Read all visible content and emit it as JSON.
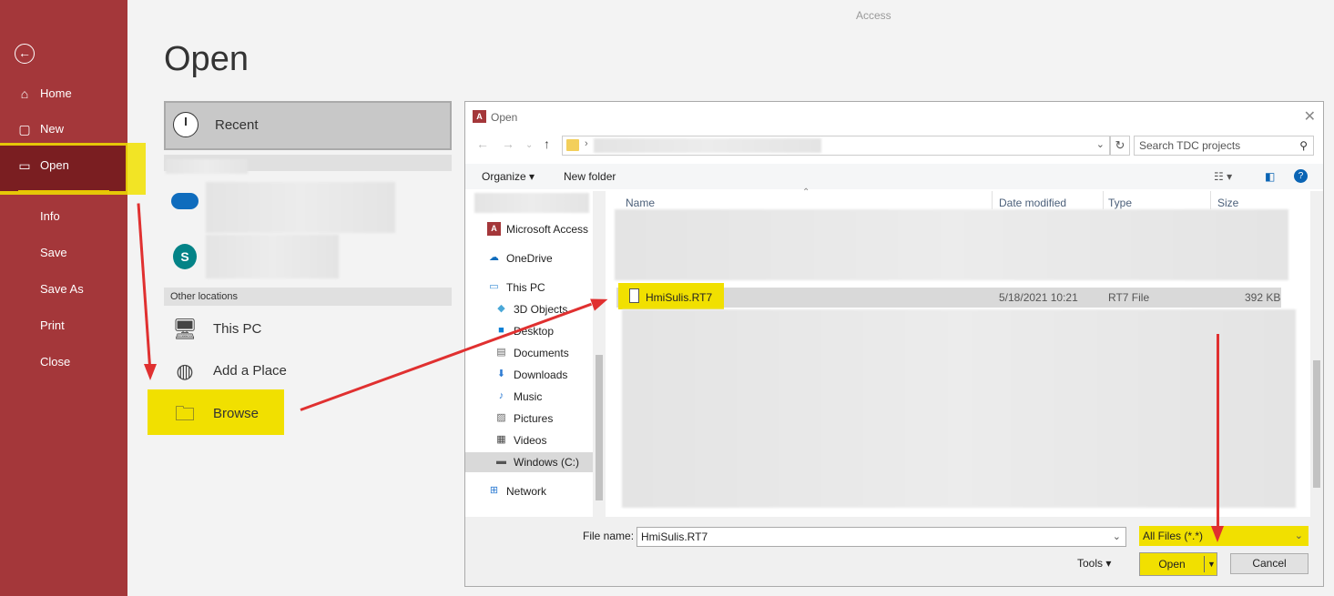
{
  "app_title": "Access",
  "backstage": {
    "back_icon": "back-arrow-icon",
    "nav": [
      {
        "label": "Home",
        "icon": "home-icon"
      },
      {
        "label": "New",
        "icon": "new-doc-icon"
      },
      {
        "label": "Open",
        "icon": "folder-open-icon",
        "active": true
      },
      {
        "label": "Info"
      },
      {
        "label": "Save"
      },
      {
        "label": "Save As"
      },
      {
        "label": "Print"
      },
      {
        "label": "Close"
      }
    ]
  },
  "open_page": {
    "title": "Open",
    "recent_label": "Recent",
    "other_locations_label": "Other locations",
    "locations": [
      {
        "label": "This PC",
        "icon": "pc-icon"
      },
      {
        "label": "Add a Place",
        "icon": "globe-icon"
      },
      {
        "label": "Browse",
        "icon": "folder-icon"
      }
    ]
  },
  "dialog": {
    "title": "Open",
    "search_placeholder": "Search TDC projects",
    "toolbar": {
      "organize": "Organize ▾",
      "new_folder": "New folder"
    },
    "tree": [
      {
        "label": "Microsoft Access",
        "icon": "access-icon"
      },
      {
        "label": "OneDrive",
        "icon": "cloud-icon"
      },
      {
        "label": "This PC",
        "icon": "pc-icon"
      },
      {
        "label": "3D Objects",
        "icon": "cube-icon"
      },
      {
        "label": "Desktop",
        "icon": "desktop-icon"
      },
      {
        "label": "Documents",
        "icon": "documents-icon"
      },
      {
        "label": "Downloads",
        "icon": "download-icon"
      },
      {
        "label": "Music",
        "icon": "music-icon"
      },
      {
        "label": "Pictures",
        "icon": "pictures-icon"
      },
      {
        "label": "Videos",
        "icon": "videos-icon"
      },
      {
        "label": "Windows (C:)",
        "icon": "drive-icon"
      },
      {
        "label": "Network",
        "icon": "network-icon"
      }
    ],
    "columns": {
      "name": "Name",
      "date": "Date modified",
      "type": "Type",
      "size": "Size"
    },
    "selected_file": {
      "name": "HmiSulis.RT7",
      "date": "5/18/2021 10:21",
      "type": "RT7 File",
      "size": "392 KB"
    },
    "file_name_label": "File name:",
    "file_name_value": "HmiSulis.RT7",
    "file_type": "All Files (*.*)",
    "tools_label": "Tools",
    "open_label": "Open",
    "cancel_label": "Cancel"
  },
  "colors": {
    "rail": "#a4373a",
    "highlight": "#f1e000",
    "arrow": "#e03030"
  }
}
